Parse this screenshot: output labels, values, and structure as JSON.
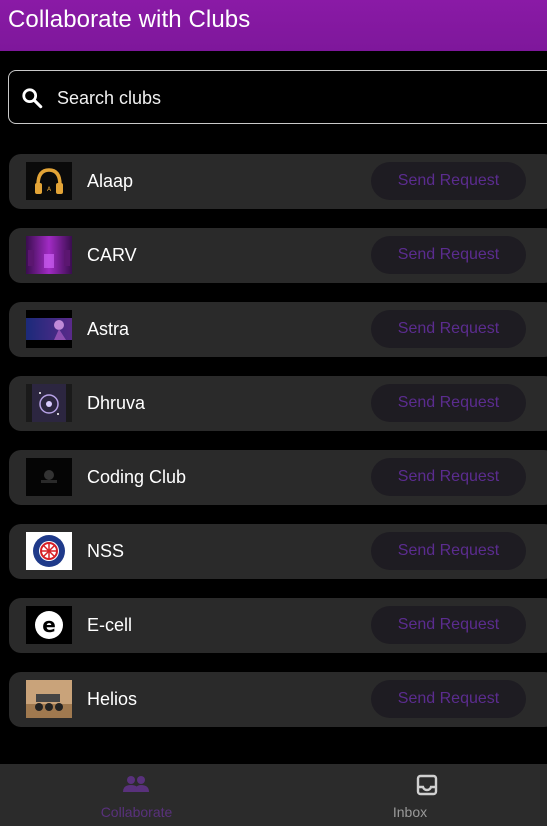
{
  "app": {
    "title": "Collaborate with Clubs"
  },
  "search": {
    "placeholder": "Search clubs",
    "value": "",
    "icon": "search-icon"
  },
  "clubs": [
    {
      "name": "Alaap",
      "button": "Send Request",
      "logo": "headphones-logo"
    },
    {
      "name": "CARV",
      "button": "Send Request",
      "logo": "purple-stage-logo"
    },
    {
      "name": "Astra",
      "button": "Send Request",
      "logo": "space-figure-logo"
    },
    {
      "name": "Dhruva",
      "button": "Send Request",
      "logo": "galaxy-poster-logo"
    },
    {
      "name": "Coding Club",
      "button": "Send Request",
      "logo": "dark-emblem-logo"
    },
    {
      "name": "NSS",
      "button": "Send Request",
      "logo": "nss-wheel-logo"
    },
    {
      "name": "E-cell",
      "button": "Send Request",
      "logo": "e-letter-logo"
    },
    {
      "name": "Helios",
      "button": "Send Request",
      "logo": "rover-logo"
    }
  ],
  "bottom_nav": {
    "items": [
      {
        "label": "Collaborate",
        "icon": "people-icon",
        "active": true
      },
      {
        "label": "Inbox",
        "icon": "inbox-icon",
        "active": false
      }
    ]
  },
  "colors": {
    "appbar": "#8a1aa6",
    "card": "#2a2a2a",
    "button_bg": "#1e1c22",
    "button_text": "#5b2c8f",
    "nav_active": "#59317c",
    "nav_inactive": "#9a9a9a"
  }
}
